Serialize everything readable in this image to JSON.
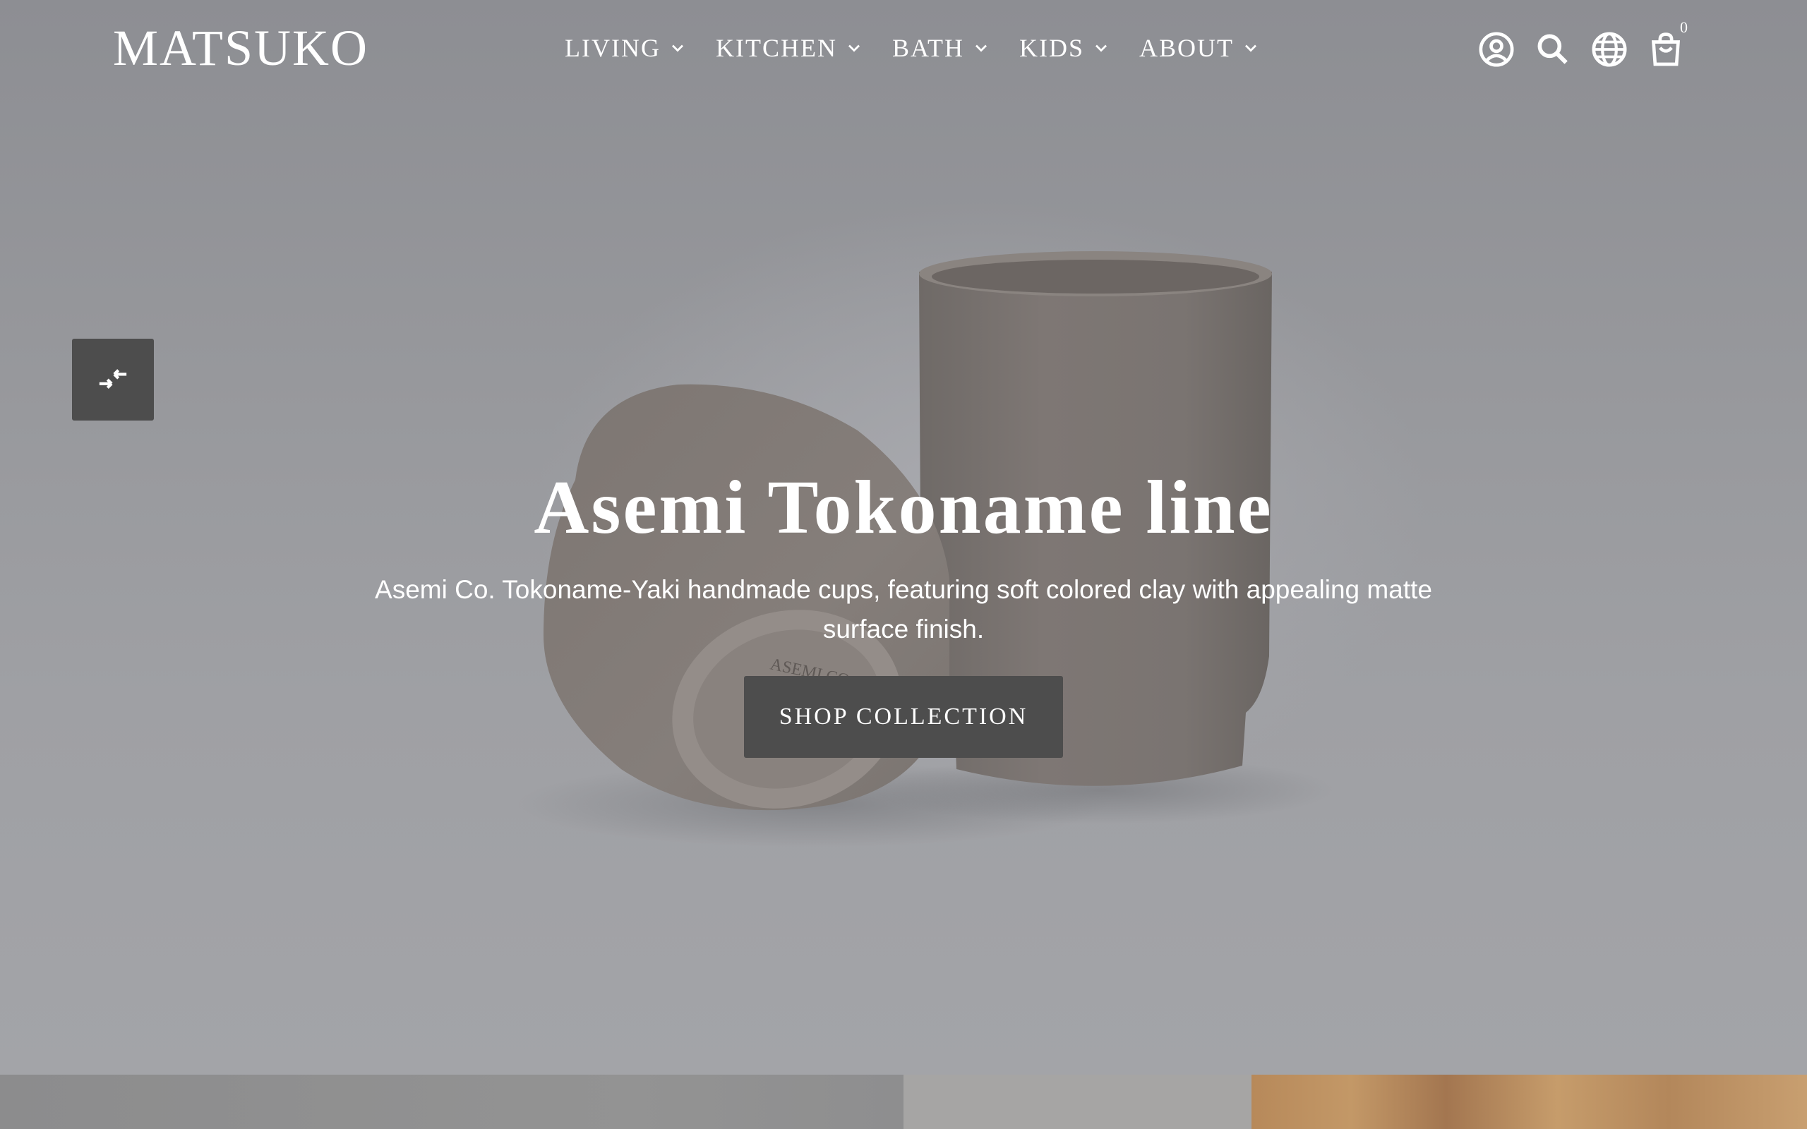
{
  "header": {
    "logo": "MATSUKO",
    "nav": [
      {
        "label": "LIVING"
      },
      {
        "label": "KITCHEN"
      },
      {
        "label": "BATH"
      },
      {
        "label": "KIDS"
      },
      {
        "label": "ABOUT"
      }
    ],
    "icons": [
      "account-icon",
      "search-icon",
      "globe-icon",
      "cart-icon"
    ],
    "cart_count": "0"
  },
  "hero": {
    "title": "Asemi Tokoname line",
    "subtitle": "Asemi Co. Tokoname-Yaki handmade cups, featuring soft colored clay with appealing matte surface finish.",
    "cta_label": "SHOP COLLECTION",
    "cup_stamp": "ASEMI CO.",
    "slide_control_icon": "pause-collapse-icon"
  },
  "colors": {
    "overlay": "#8f9095",
    "button": "#4d4d4d",
    "text": "#ffffff",
    "cup": "#7a7470"
  }
}
